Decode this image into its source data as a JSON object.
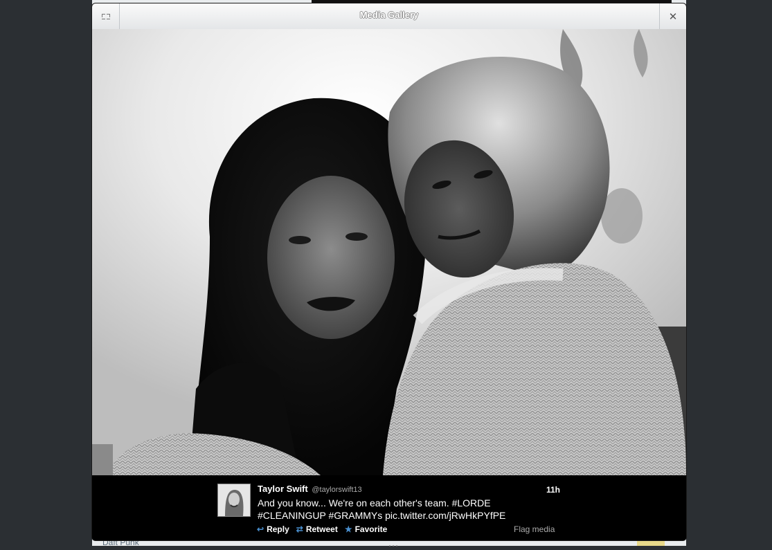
{
  "background": {
    "left_text": "Daft Punk",
    "right_text": "…"
  },
  "gallery": {
    "title": "Media Gallery",
    "close_glyph": "✕"
  },
  "tweet": {
    "author_name": "Taylor Swift",
    "author_handle": "@taylorswift13",
    "time": "11h",
    "text_line1": "And you know... We're on each other's team. #LORDE",
    "text_line2": "#CLEANINGUP #GRAMMYs pic.twitter.com/jRwHkPYfPE"
  },
  "actions": {
    "reply_label": "Reply",
    "reply_icon": "reply-arrow",
    "retweet_label": "Retweet",
    "retweet_icon": "retweet-arrows",
    "favorite_label": "Favorite",
    "favorite_icon": "star",
    "flag_label": "Flag media"
  },
  "colors": {
    "action_icon": "#4a90d0",
    "titlebar_top": "#fafafa",
    "titlebar_bottom": "#e4e6e8"
  }
}
